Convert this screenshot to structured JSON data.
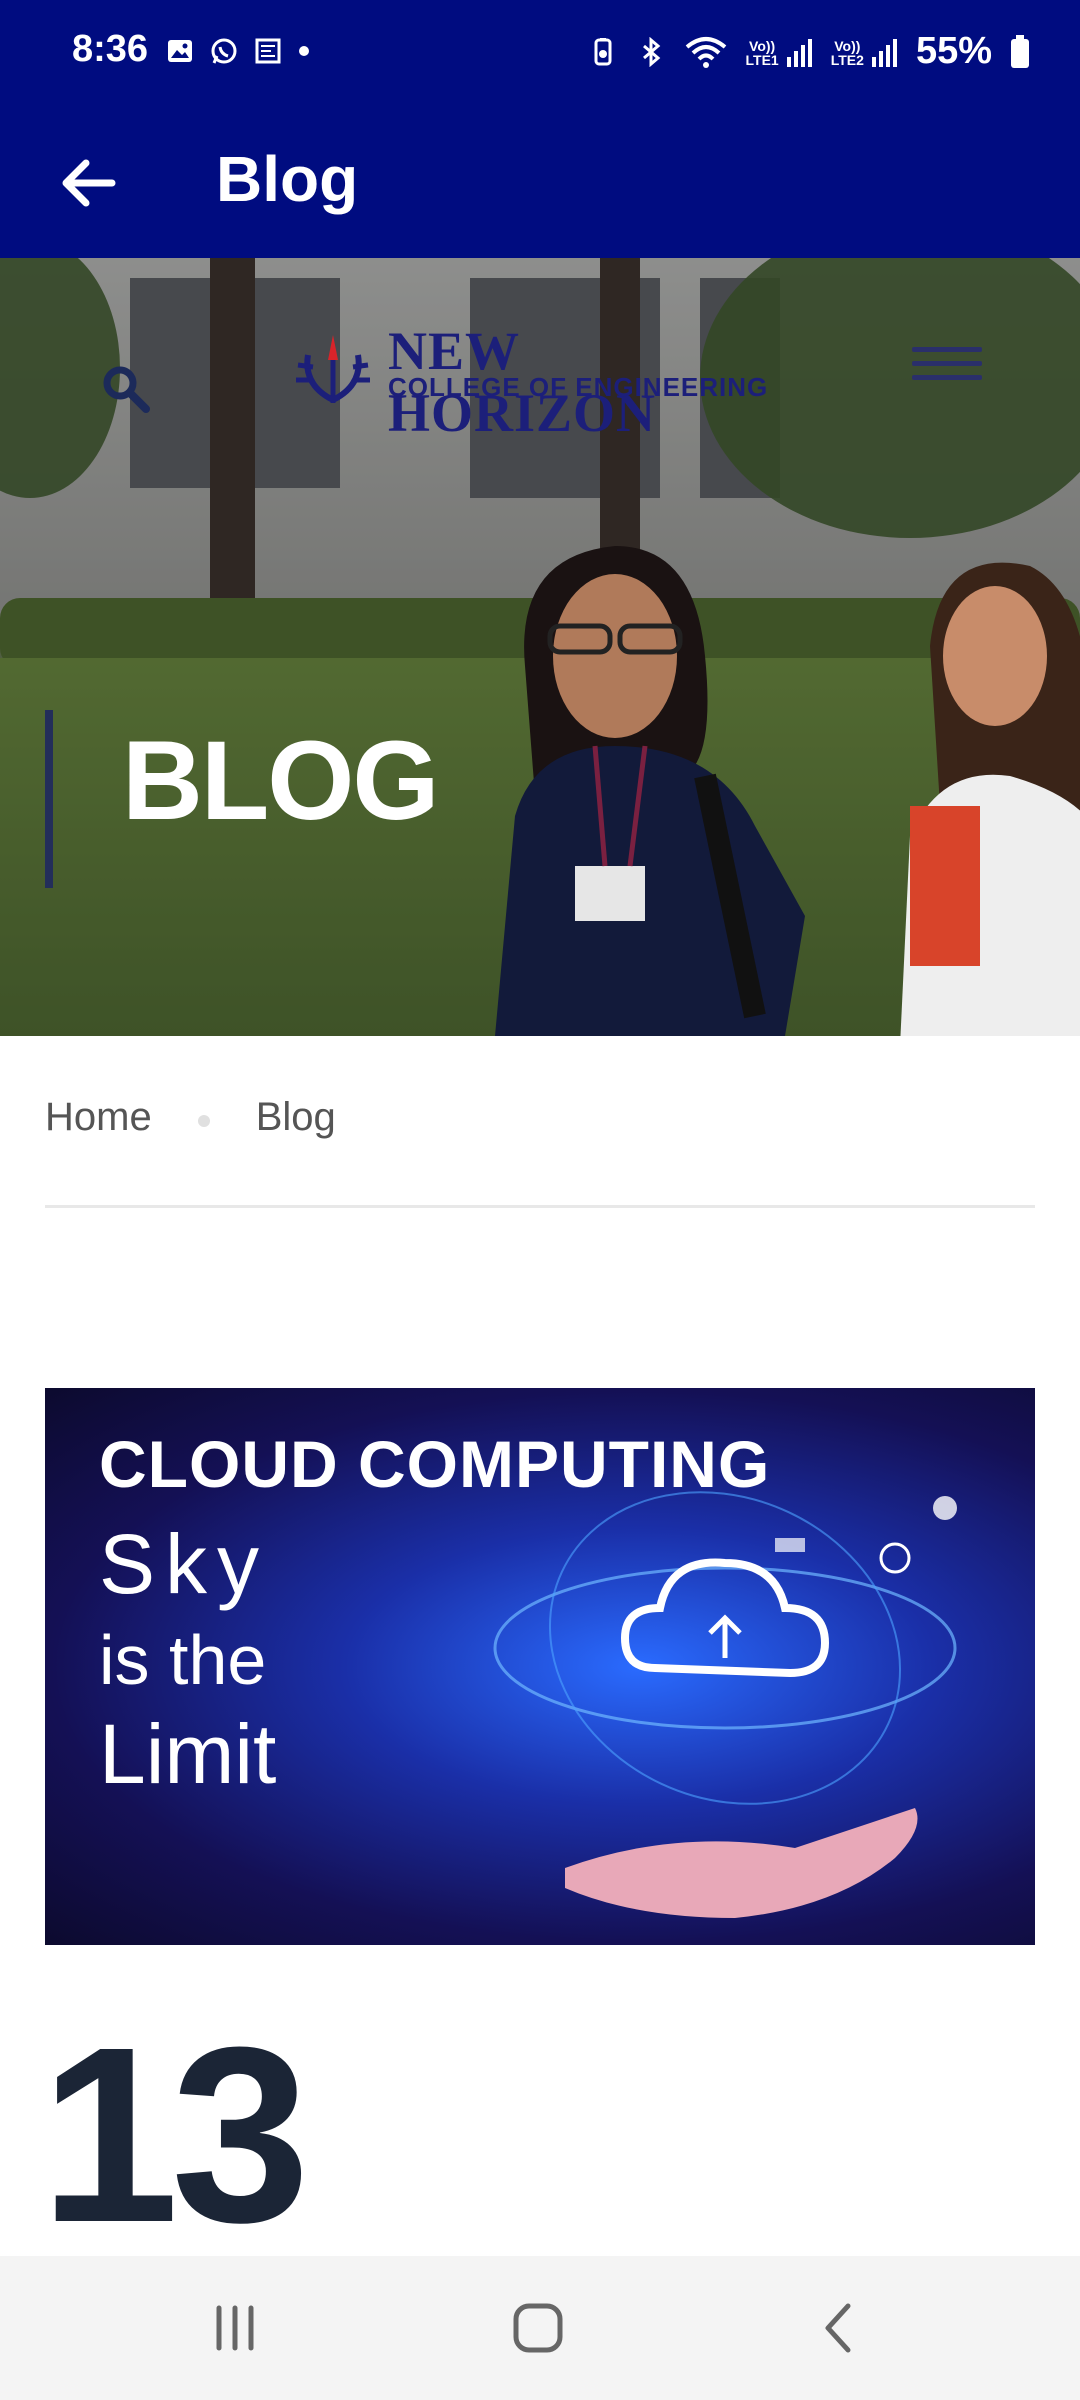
{
  "status_bar": {
    "time": "8:36",
    "lte1": "LTE1",
    "lte2": "LTE2",
    "battery": "55%",
    "volte": "Vo))"
  },
  "app_bar": {
    "title": "Blog",
    "back_icon": "arrow-left-icon"
  },
  "hero": {
    "logo_main": "NEW HORIZON",
    "logo_sub": "COLLEGE OF ENGINEERING",
    "heading": "BLOG",
    "search_icon": "search-icon",
    "menu_icon": "hamburger-menu-icon"
  },
  "breadcrumb": {
    "items": [
      "Home",
      "Blog"
    ]
  },
  "post": {
    "image_lines": [
      "CLOUD COMPUTING",
      "Sky",
      "is the",
      "Limit"
    ],
    "day": "13"
  },
  "nav_bar": {
    "icons": [
      "recents-icon",
      "home-icon",
      "back-icon"
    ]
  },
  "colors": {
    "primary": "#000c80",
    "heading_dark": "#1b2536"
  }
}
